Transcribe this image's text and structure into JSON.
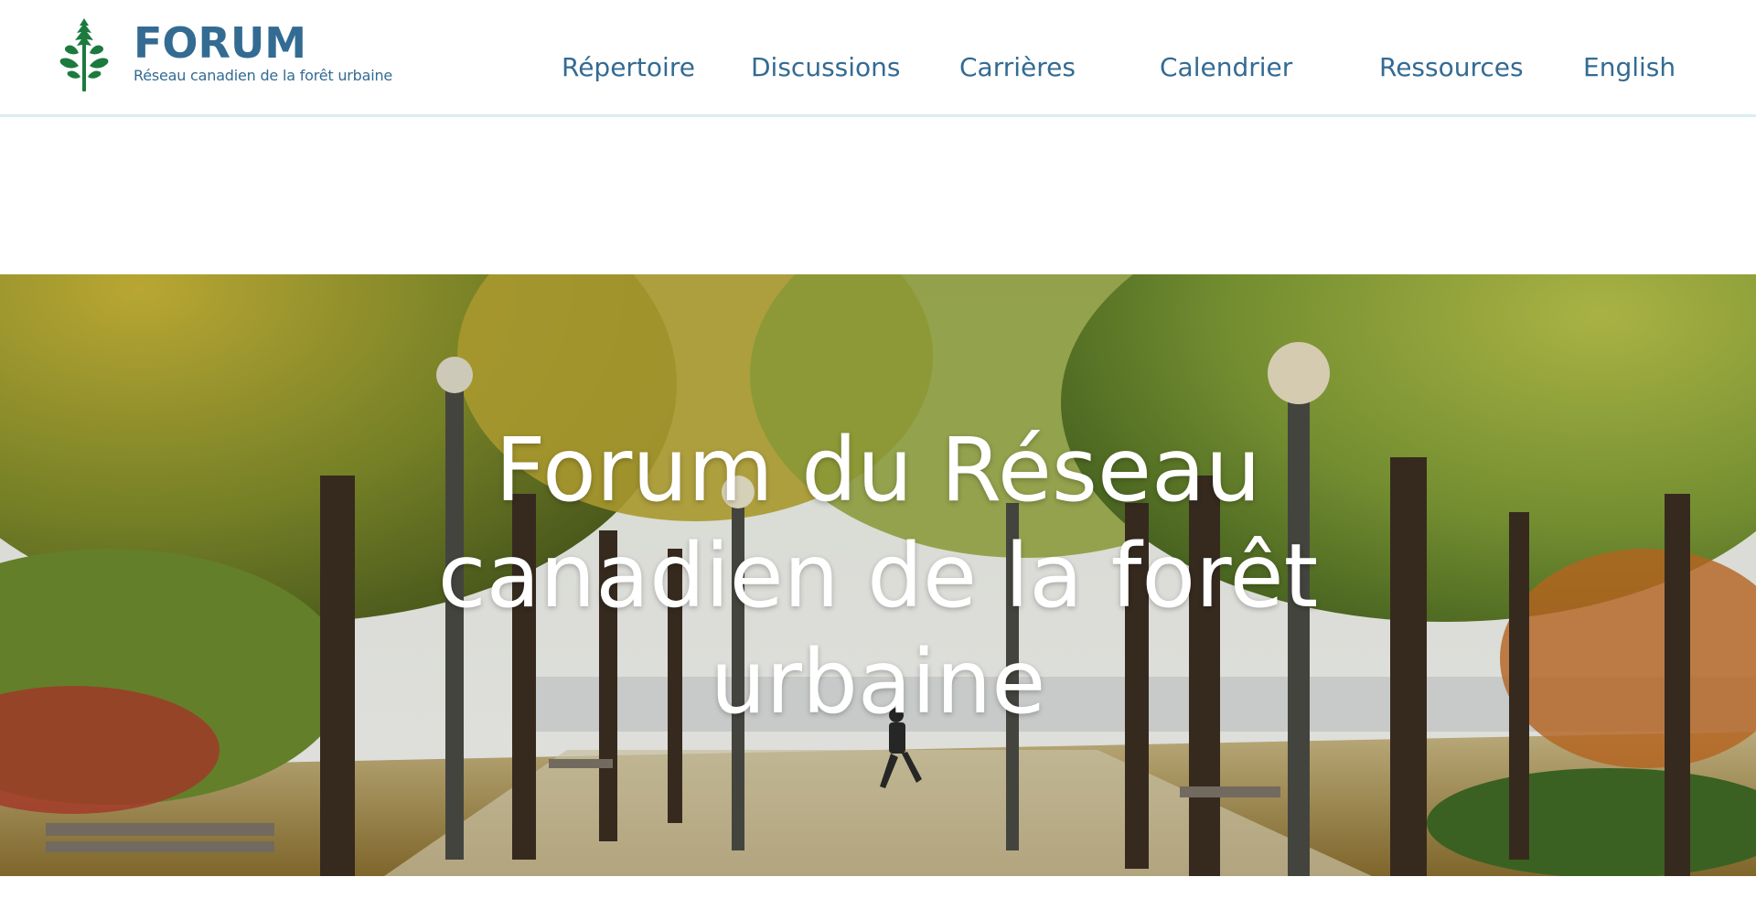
{
  "brand": {
    "title": "FORUM",
    "subtitle": "Réseau canadien de la forêt urbaine",
    "logo_icon": "maple-tree-icon",
    "color": "#336b93",
    "logo_color": "#1c7a3e"
  },
  "nav": {
    "items": [
      {
        "label": "Répertoire"
      },
      {
        "label": "Discussions"
      },
      {
        "label": "Carrières"
      },
      {
        "label": "Calendrier"
      },
      {
        "label": "Ressources"
      },
      {
        "label": "English"
      }
    ]
  },
  "hero": {
    "title": "Forum du Réseau canadien de la forêt urbaine",
    "image": "autumn-park-tree-lined-path"
  }
}
